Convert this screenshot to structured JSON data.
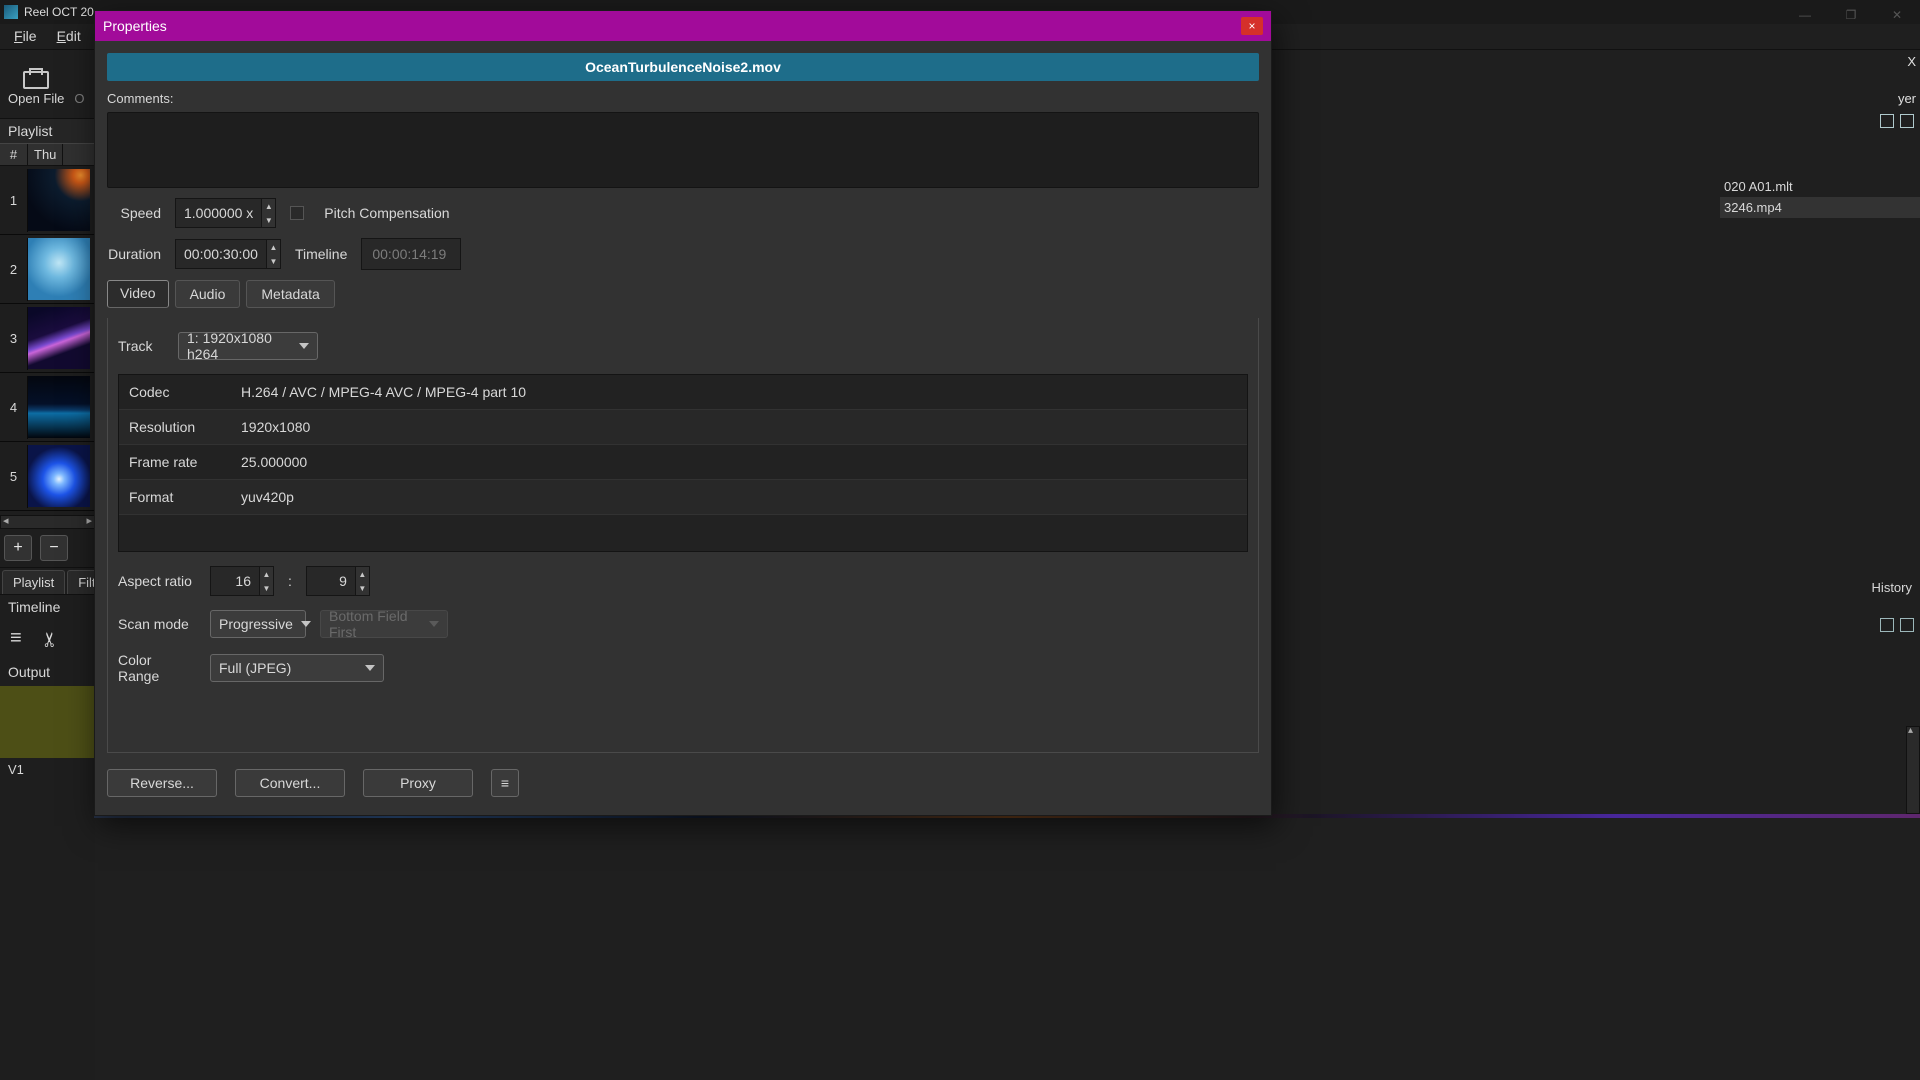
{
  "app": {
    "title": "Reel OCT 20",
    "menus": {
      "file": "File",
      "edit": "Edit"
    },
    "toolbar": {
      "open_file": "Open File",
      "open_other_partial": "O"
    },
    "win": {
      "min": "—",
      "max": "❐",
      "close": "✕"
    }
  },
  "playlist": {
    "title": "Playlist",
    "col_num": "#",
    "col_thumb": "Thu",
    "rows": [
      "1",
      "2",
      "3",
      "4",
      "5"
    ],
    "btn_add": "+",
    "btn_remove": "−",
    "tab_playlist": "Playlist",
    "tab_filters_partial": "Filt"
  },
  "timeline": {
    "title": "Timeline",
    "menu_icon": "≡",
    "cut_icon": "✂",
    "output": "Output",
    "track": "V1"
  },
  "right": {
    "x_suffix": "X",
    "tab_partial": "yer",
    "file1": "020 A01.mlt",
    "file2": "3246.mp4",
    "history": "History"
  },
  "dialog": {
    "title": "Properties",
    "close": "×",
    "filename": "OceanTurbulenceNoise2.mov",
    "comments_label": "Comments:",
    "speed_label": "Speed",
    "speed_value": "1.000000 x",
    "pitch_label": "Pitch Compensation",
    "duration_label": "Duration",
    "duration_value": "00:00:30:00",
    "timeline_label": "Timeline",
    "timeline_value": "00:00:14:19",
    "tabs": {
      "video": "Video",
      "audio": "Audio",
      "metadata": "Metadata"
    },
    "track_label": "Track",
    "track_value": "1: 1920x1080 h264",
    "info": {
      "codec_k": "Codec",
      "codec_v": "H.264 / AVC / MPEG-4 AVC / MPEG-4 part 10",
      "resolution_k": "Resolution",
      "resolution_v": "1920x1080",
      "fps_k": "Frame rate",
      "fps_v": "25.000000",
      "format_k": "Format",
      "format_v": "yuv420p"
    },
    "aspect_label": "Aspect ratio",
    "aspect_w": "16",
    "aspect_sep": ":",
    "aspect_h": "9",
    "scan_label": "Scan mode",
    "scan_value": "Progressive",
    "field_value": "Bottom Field First",
    "color_label": "Color Range",
    "color_value": "Full (JPEG)",
    "btn_reverse": "Reverse...",
    "btn_convert": "Convert...",
    "btn_proxy": "Proxy",
    "btn_menu": "≡"
  }
}
